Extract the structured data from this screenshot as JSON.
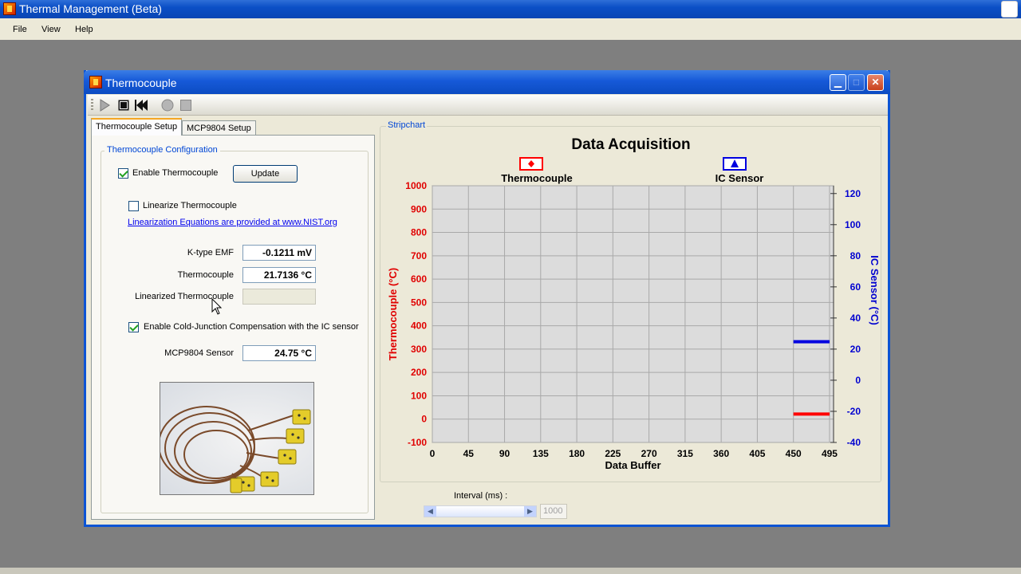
{
  "app": {
    "title": "Thermal Management (Beta)",
    "menu": [
      "File",
      "View",
      "Help"
    ]
  },
  "child_window": {
    "title": "Thermocouple",
    "buttons": [
      "minimize",
      "maximize",
      "close"
    ]
  },
  "toolbar": {
    "icons": [
      "play-icon",
      "stop-icon",
      "rewind-icon",
      "record-icon",
      "square-icon"
    ]
  },
  "tabs": [
    {
      "label": "Thermocouple Setup",
      "active": true
    },
    {
      "label": "MCP9804 Setup",
      "active": false
    }
  ],
  "config": {
    "group_label": "Thermocouple Configuration",
    "enable_label": "Enable Thermocouple",
    "enable_checked": true,
    "update_label": "Update",
    "linearize_label": "Linearize Thermocouple",
    "linearize_checked": false,
    "nist_link": "Linearization Equations are provided at www.NIST.org",
    "emf_label": "K-type EMF",
    "emf_value": "-0.1211 mV",
    "tc_label": "Thermocouple",
    "tc_value": "21.7136 °C",
    "lin_tc_label": "Linearized Thermocouple",
    "lin_tc_value": "",
    "cjc_label": "Enable Cold-Junction Compensation with the IC sensor",
    "cjc_checked": true,
    "mcp_label": "MCP9804 Sensor",
    "mcp_value": "24.75 °C"
  },
  "stripchart": {
    "group_label": "Stripchart",
    "interval_label": "Interval (ms) :",
    "interval_value": "1000"
  },
  "colors": {
    "thermocouple": "#ff0000",
    "ic_sensor": "#0000e0",
    "plot_bg": "#dcdcdc"
  },
  "chart_data": {
    "type": "line",
    "title": "Data Acquisition",
    "xlabel": "Data Buffer",
    "ylabel": "Thermocouple (°C)",
    "y2label": "IC Sensor (°C)",
    "xlim": [
      0,
      500
    ],
    "ylim": [
      -100,
      1000
    ],
    "y2lim": [
      -40,
      125
    ],
    "x_ticks": [
      0,
      45,
      90,
      135,
      180,
      225,
      270,
      315,
      360,
      405,
      450,
      495
    ],
    "y_ticks": [
      -100,
      0,
      100,
      200,
      300,
      400,
      500,
      600,
      700,
      800,
      900,
      1000
    ],
    "y2_ticks": [
      -40,
      -20,
      0,
      20,
      40,
      60,
      80,
      100,
      120
    ],
    "grid": true,
    "legend_placement": "top",
    "series": [
      {
        "name": "Thermocouple",
        "axis": "left",
        "color": "#ff0000",
        "marker": "diamond",
        "x": [
          450,
          495
        ],
        "y": [
          21.7,
          21.7
        ]
      },
      {
        "name": "IC Sensor",
        "axis": "right",
        "color": "#0000e0",
        "marker": "triangle",
        "x": [
          450,
          495
        ],
        "y": [
          24.75,
          24.75
        ]
      }
    ]
  }
}
